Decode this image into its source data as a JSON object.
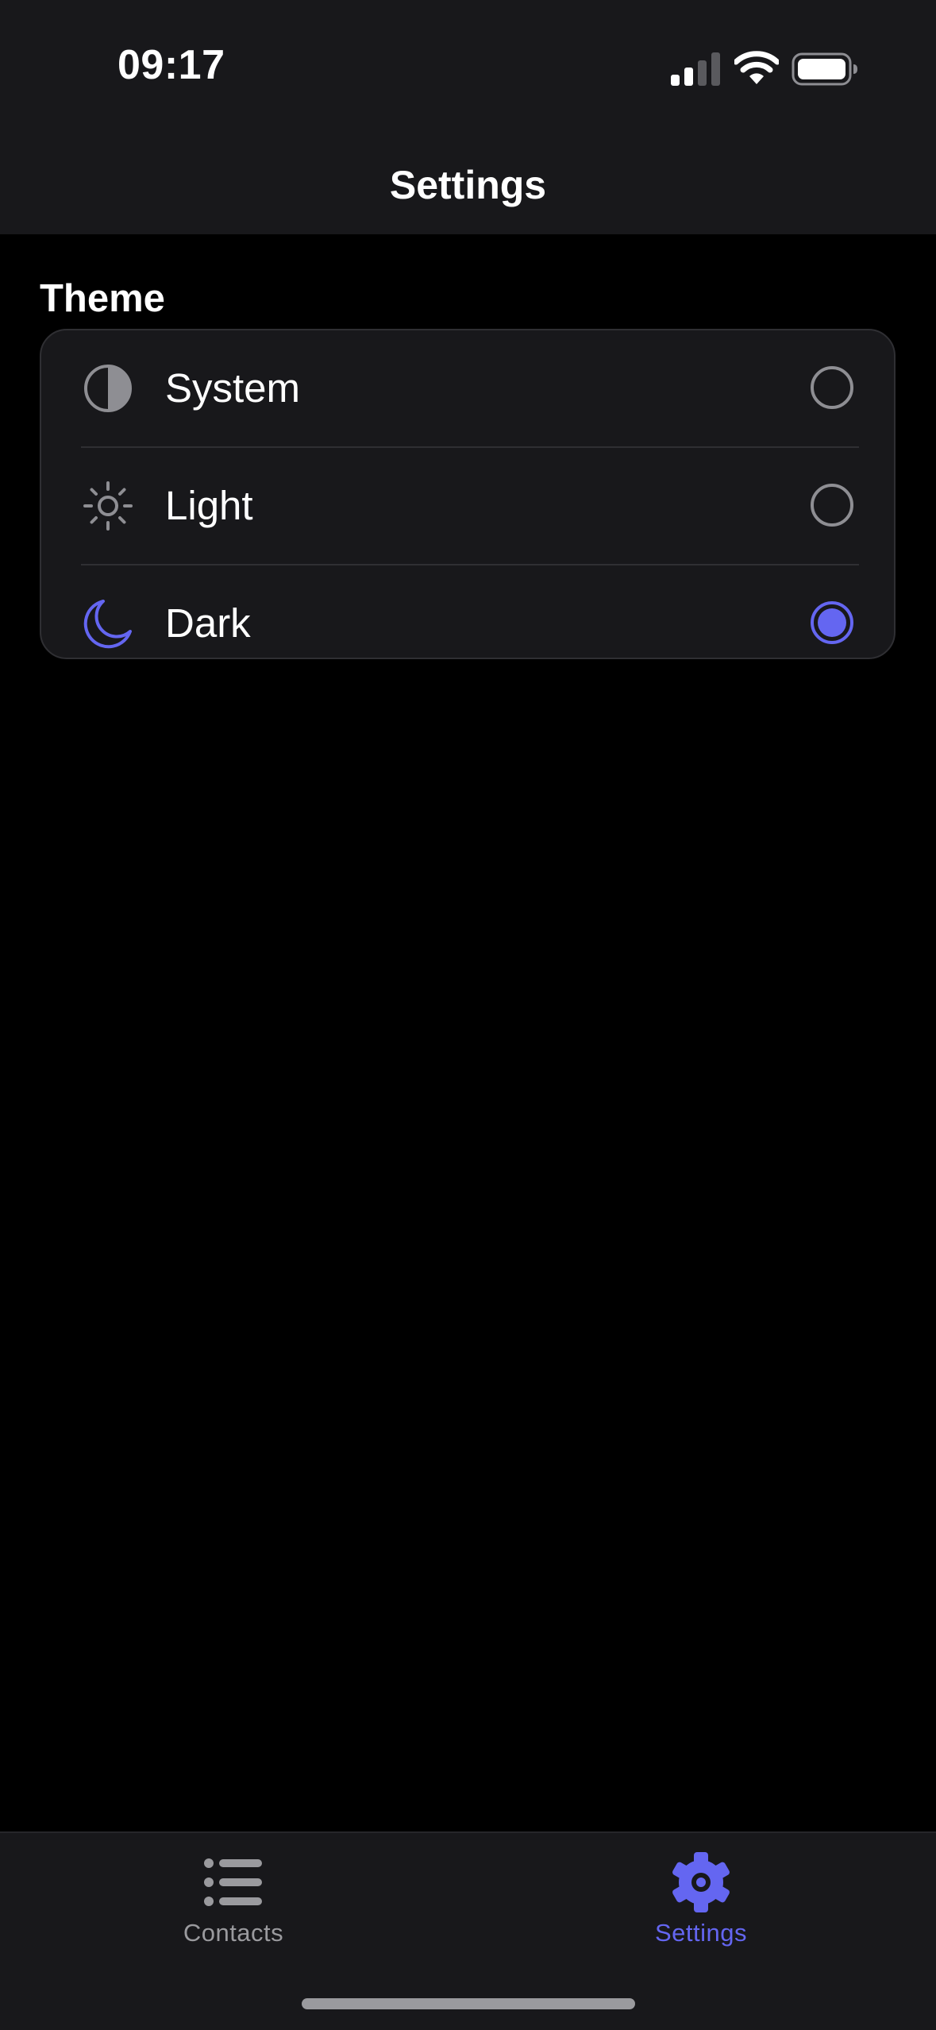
{
  "status_bar": {
    "time": "09:17"
  },
  "nav": {
    "title": "Settings"
  },
  "theme_section": {
    "title": "Theme",
    "options": [
      {
        "label": "System",
        "icon": "half-circle-icon",
        "selected": false
      },
      {
        "label": "Light",
        "icon": "sun-icon",
        "selected": false
      },
      {
        "label": "Dark",
        "icon": "moon-icon",
        "selected": true
      }
    ]
  },
  "tab_bar": {
    "tabs": [
      {
        "label": "Contacts",
        "icon": "list-icon",
        "active": false
      },
      {
        "label": "Settings",
        "icon": "gear-icon",
        "active": true
      }
    ]
  },
  "colors": {
    "accent": "#6466f1",
    "inactive": "#9a9a9e",
    "surface": "#18181b",
    "background": "#000000"
  }
}
